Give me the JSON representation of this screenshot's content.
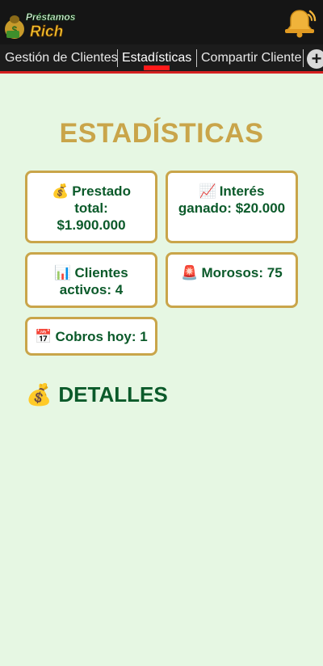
{
  "app": {
    "logo_line1": "Préstamos",
    "logo_line2": "Rich",
    "icons": {
      "logo": "money-bag-logo-icon",
      "bell": "bell-icon"
    }
  },
  "tabs": [
    {
      "label": "Gestión de Clientes",
      "active": false
    },
    {
      "label": "Estadísticas",
      "active": true
    },
    {
      "label": "Compartir Cliente",
      "active": false
    }
  ],
  "tab_add_glyph": "+",
  "page": {
    "title": "ESTADÍSTICAS",
    "details_heading": "DETALLES",
    "details_icon": "💰"
  },
  "stats": {
    "prestado": {
      "icon": "💰",
      "line1": "Prestado",
      "line2": "total:",
      "line3": "$1.900.000"
    },
    "interes": {
      "icon": "📈",
      "line1": "Interés",
      "line2": "ganado: $20.000"
    },
    "clientes": {
      "icon": "📊",
      "line1": "Clientes",
      "line2": "activos: 4"
    },
    "morosos": {
      "icon": "🚨",
      "label": "Morosos: 75"
    },
    "cobros": {
      "icon": "📅",
      "label": "Cobros hoy: 1"
    }
  },
  "colors": {
    "background": "#e6f7e3",
    "gold": "#c9a54a",
    "green_text": "#0b5a2a",
    "tab_indicator": "#ff1a1a"
  }
}
